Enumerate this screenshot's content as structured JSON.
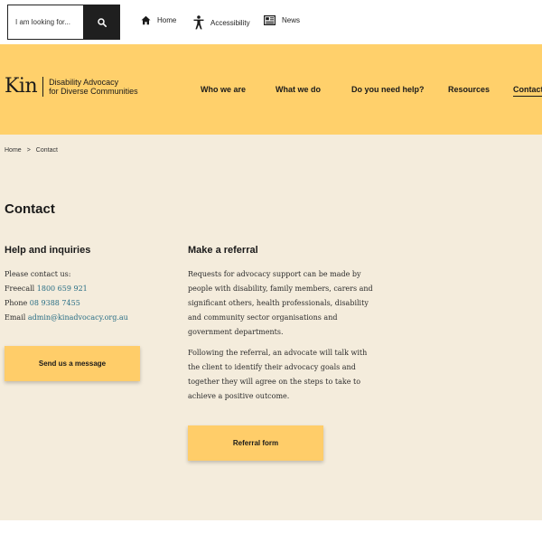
{
  "topbar": {
    "search_placeholder": "I am looking for...",
    "search_icon": "search-icon",
    "links": [
      {
        "label": "Home",
        "icon": "home-icon"
      },
      {
        "label": "Accessibility",
        "icon": "accessibility-icon"
      },
      {
        "label": "News",
        "icon": "news-icon"
      }
    ]
  },
  "header": {
    "logo_mark": "Kin",
    "logo_line1": "Disability Advocacy",
    "logo_line2": "for Diverse Communities",
    "nav": [
      "Who we are",
      "What we do",
      "Do you need help?",
      "Resources",
      "Contact"
    ],
    "active_nav": "Contact"
  },
  "breadcrumb": {
    "home": "Home",
    "separator": ">",
    "current": "Contact"
  },
  "page": {
    "title": "Contact"
  },
  "help": {
    "heading": "Help and inquiries",
    "intro": "Please contact us:",
    "freecall_label": "Freecall",
    "freecall_number": "1800 659 921",
    "phone_label": "Phone",
    "phone_number": "08 9388 7455",
    "email_label": "Email",
    "email_address": "admin@kinadvocacy.org.au",
    "button": "Send us a message"
  },
  "referral": {
    "heading": "Make a referral",
    "para1_lines": [
      "Requests for advocacy support can be made by",
      "people with disability, family members, carers and",
      "significant others, health professionals, disability",
      "and community sector organisations and",
      "government departments."
    ],
    "para2_lines": [
      "Following the referral, an advocate will talk with",
      "the client to identify their advocacy goals and",
      "together they will agree on the steps to take to",
      "achieve a positive outcome."
    ],
    "button": "Referral form"
  },
  "colors": {
    "header_bg": "#ffd06b",
    "content_bg": "#f4ecdc",
    "button_bg": "#ffcd69",
    "link": "#2a6f86",
    "search_button": "#1f1f1f"
  }
}
